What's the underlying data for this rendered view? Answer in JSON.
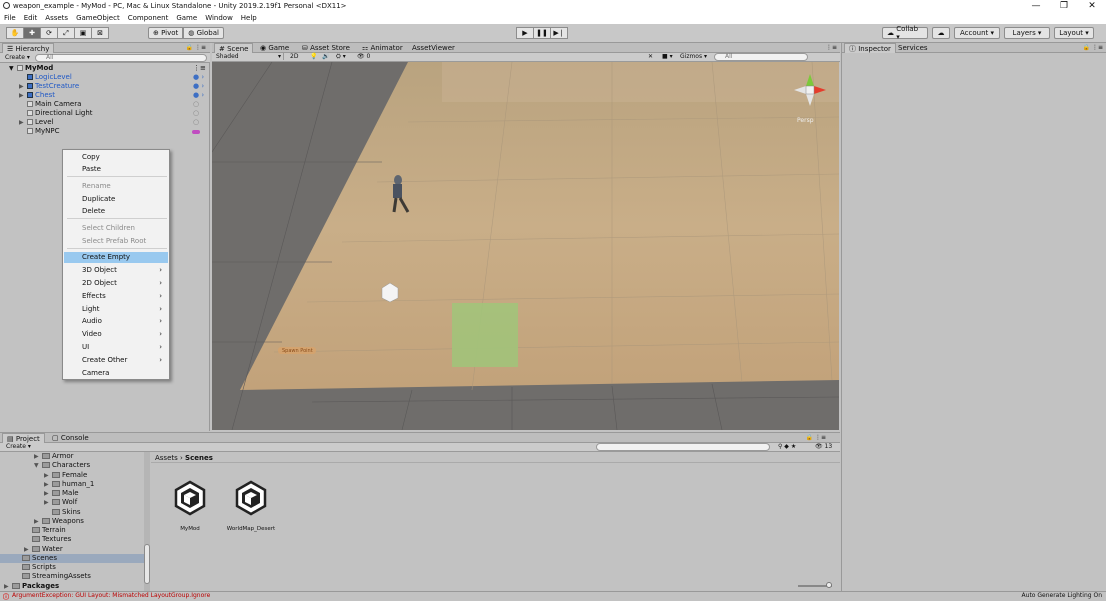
{
  "window": {
    "title": "weapon_example - MyMod - PC, Mac & Linux Standalone - Unity 2019.2.19f1 Personal <DX11>",
    "minimize": "—",
    "maximize": "❐",
    "close": "✕"
  },
  "menu": [
    "File",
    "Edit",
    "Assets",
    "GameObject",
    "Component",
    "Game",
    "Window",
    "Help"
  ],
  "toolbar": {
    "tools": [
      "hand-tool",
      "move-tool",
      "rotate-tool",
      "scale-tool",
      "rect-tool",
      "transform-tool"
    ],
    "pivot_label": "Pivot",
    "global_label": "Global",
    "collab_label": "Collab ▾",
    "account_label": "Account ▾",
    "layers_label": "Layers ▾",
    "layout_label": "Layout ▾"
  },
  "hierarchy": {
    "tab": "Hierarchy",
    "create": "Create ▾",
    "search_placeholder": "All",
    "scene_name": "MyMod",
    "items": [
      {
        "label": "LogicLevel",
        "blue": true
      },
      {
        "label": "TestCreature",
        "blue": true
      },
      {
        "label": "Chest",
        "blue": true
      },
      {
        "label": "Main Camera",
        "blue": false
      },
      {
        "label": "Directional Light",
        "blue": false
      },
      {
        "label": "Level",
        "blue": false
      },
      {
        "label": "MyNPC",
        "blue": false
      }
    ]
  },
  "context_menu": {
    "items": [
      {
        "label": "Copy",
        "disabled": false
      },
      {
        "label": "Paste",
        "disabled": false
      },
      {
        "label": "Rename",
        "disabled": true
      },
      {
        "label": "Duplicate",
        "disabled": false
      },
      {
        "label": "Delete",
        "disabled": false
      },
      {
        "label": "Select Children",
        "disabled": true
      },
      {
        "label": "Select Prefab Root",
        "disabled": true
      },
      {
        "label": "Create Empty",
        "selected": true
      },
      {
        "label": "3D Object",
        "submenu": true
      },
      {
        "label": "2D Object",
        "submenu": true
      },
      {
        "label": "Effects",
        "submenu": true
      },
      {
        "label": "Light",
        "submenu": true
      },
      {
        "label": "Audio",
        "submenu": true
      },
      {
        "label": "Video",
        "submenu": true
      },
      {
        "label": "UI",
        "submenu": true
      },
      {
        "label": "Create Other",
        "submenu": true
      },
      {
        "label": "Camera",
        "submenu": false
      }
    ]
  },
  "scene_tabs": [
    "Scene",
    "Game",
    "Asset Store",
    "Animator",
    "AssetViewer"
  ],
  "scene_bar": {
    "shading": "Shaded",
    "mode_2d": "2D",
    "fx_count": "0",
    "gizmos": "Gizmos ▾",
    "search_placeholder": "All",
    "persp": "Persp",
    "spawn_label": "Spawn Point"
  },
  "inspector_tabs": [
    "Inspector",
    "Services"
  ],
  "project": {
    "tabs": [
      "Project",
      "Console"
    ],
    "create": "Create ▾",
    "count": "13",
    "breadcrumb": [
      "Assets",
      "Scenes"
    ],
    "tree": [
      {
        "label": "Armor",
        "indent": 3,
        "arrow": "▶"
      },
      {
        "label": "Characters",
        "indent": 3,
        "arrow": "▼"
      },
      {
        "label": "Female",
        "indent": 4,
        "arrow": "▶"
      },
      {
        "label": "human_1",
        "indent": 4,
        "arrow": "▶"
      },
      {
        "label": "Male",
        "indent": 4,
        "arrow": "▶"
      },
      {
        "label": "Wolf",
        "indent": 4,
        "arrow": "▶"
      },
      {
        "label": "Skins",
        "indent": 4,
        "arrow": ""
      },
      {
        "label": "Weapons",
        "indent": 3,
        "arrow": "▶"
      },
      {
        "label": "Terrain",
        "indent": 2,
        "arrow": ""
      },
      {
        "label": "Textures",
        "indent": 2,
        "arrow": ""
      },
      {
        "label": "Water",
        "indent": 2,
        "arrow": "▶"
      },
      {
        "label": "Scenes",
        "indent": 1,
        "arrow": "",
        "selected": true
      },
      {
        "label": "Scripts",
        "indent": 1,
        "arrow": ""
      },
      {
        "label": "StreamingAssets",
        "indent": 1,
        "arrow": ""
      },
      {
        "label": "Packages",
        "indent": 0,
        "arrow": "▶",
        "bold": true
      }
    ],
    "assets": [
      "MyMod",
      "WorldMap_Desert"
    ]
  },
  "status": {
    "error": "ArgumentException: GUI Layout: Mismatched LayoutGroup.Ignore",
    "right": "Auto Generate Lighting On"
  }
}
